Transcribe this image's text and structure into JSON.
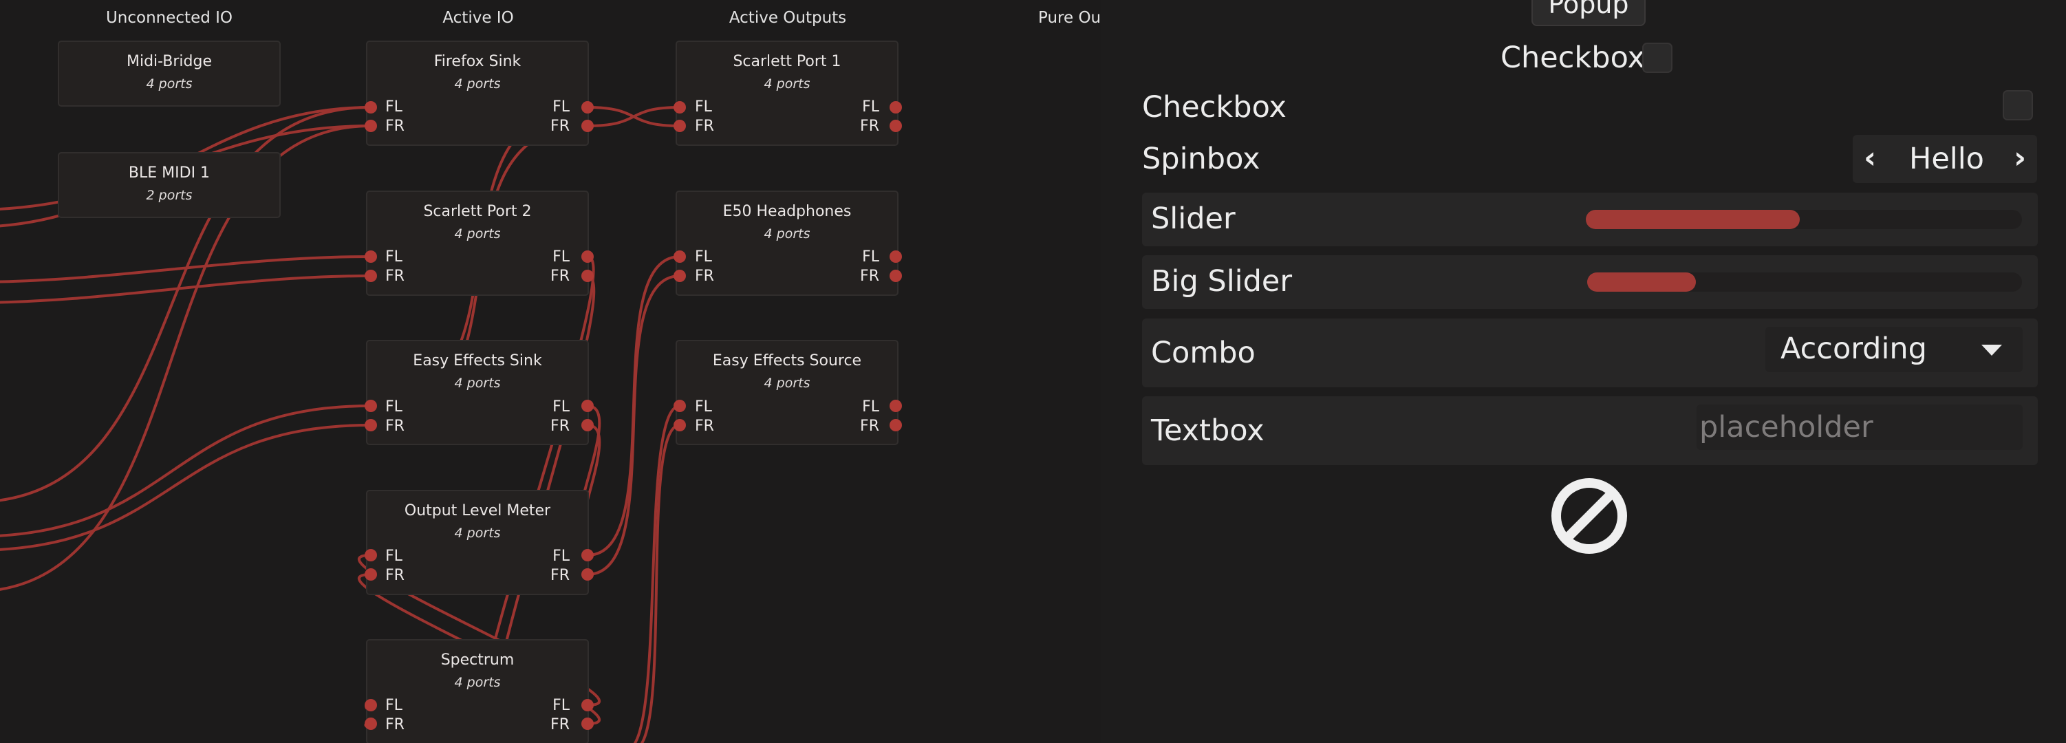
{
  "graph": {
    "columns": [
      {
        "title": "Unconnected IO"
      },
      {
        "title": "Active IO"
      },
      {
        "title": "Active Outputs"
      },
      {
        "title": "Pure Ou"
      }
    ],
    "nodes": {
      "midi_bridge": {
        "title": "Midi-Bridge",
        "sub": "4 ports"
      },
      "ble_midi": {
        "title": "BLE MIDI 1",
        "sub": "2 ports"
      },
      "firefox_sink": {
        "title": "Firefox Sink",
        "sub": "4 ports",
        "ports": [
          "FL",
          "FR"
        ]
      },
      "scarlett_port2": {
        "title": "Scarlett Port 2",
        "sub": "4 ports",
        "ports": [
          "FL",
          "FR"
        ]
      },
      "easy_effects_sink": {
        "title": "Easy Effects Sink",
        "sub": "4 ports",
        "ports": [
          "FL",
          "FR"
        ]
      },
      "output_level_meter": {
        "title": "Output Level Meter",
        "sub": "4 ports",
        "ports": [
          "FL",
          "FR"
        ]
      },
      "spectrum": {
        "title": "Spectrum",
        "sub": "4 ports",
        "ports": [
          "FL",
          "FR"
        ]
      },
      "scarlett_port1": {
        "title": "Scarlett Port 1",
        "sub": "4 ports",
        "ports": [
          "FL",
          "FR"
        ]
      },
      "e50_headphones": {
        "title": "E50 Headphones",
        "sub": "4 ports",
        "ports": [
          "FL",
          "FR"
        ]
      },
      "easy_effects_source": {
        "title": "Easy Effects Source",
        "sub": "4 ports",
        "ports": [
          "FL",
          "FR"
        ]
      }
    },
    "wire_color": "#9c3430",
    "port_color": "#b13a35"
  },
  "panel": {
    "popup_label": "Popup",
    "checkbox_top_label": "Checkbox",
    "checkbox_label": "Checkbox",
    "spinbox_label": "Spinbox",
    "spinbox_value": "Hello",
    "slider_label": "Slider",
    "slider_value": 0.49,
    "big_slider_label": "Big Slider",
    "big_slider_value": 0.25,
    "combo_label": "Combo",
    "combo_value": "According",
    "textbox_label": "Textbox",
    "textbox_placeholder": "placeholder",
    "disabled_icon": "forbidden-icon",
    "accent_color": "#a13a36"
  }
}
